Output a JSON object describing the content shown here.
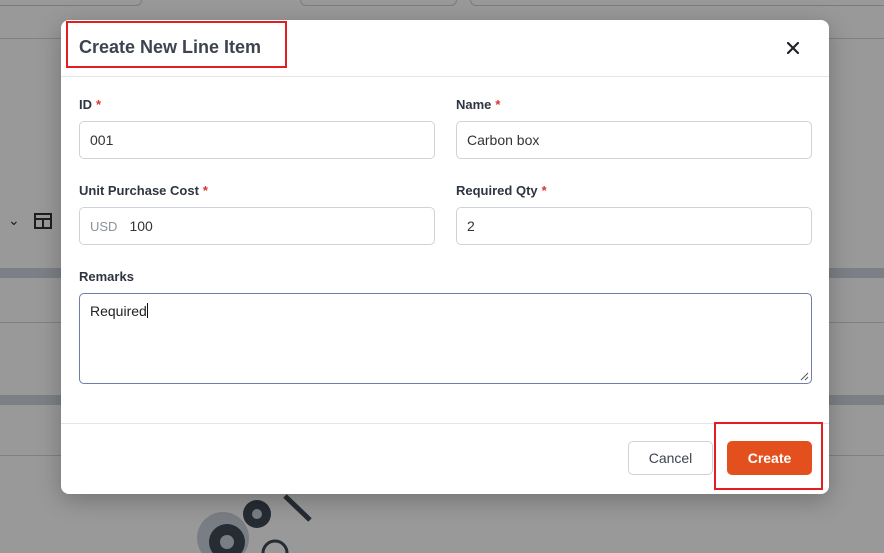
{
  "modal": {
    "title": "Create New Line Item",
    "fields": {
      "id": {
        "label": "ID",
        "required_mark": "*",
        "value": "001"
      },
      "name": {
        "label": "Name",
        "required_mark": "*",
        "value": "Carbon box"
      },
      "unit_cost": {
        "label": "Unit Purchase Cost",
        "required_mark": "*",
        "currency": "USD",
        "value": "100"
      },
      "required_qty": {
        "label": "Required Qty",
        "required_mark": "*",
        "value": "2"
      },
      "remarks": {
        "label": "Remarks",
        "value": "Required"
      }
    },
    "buttons": {
      "cancel": "Cancel",
      "create": "Create"
    }
  },
  "colors": {
    "primary": "#e4501d",
    "required": "#d9342b",
    "highlight": "#e02020",
    "title_text": "#3d4450"
  }
}
